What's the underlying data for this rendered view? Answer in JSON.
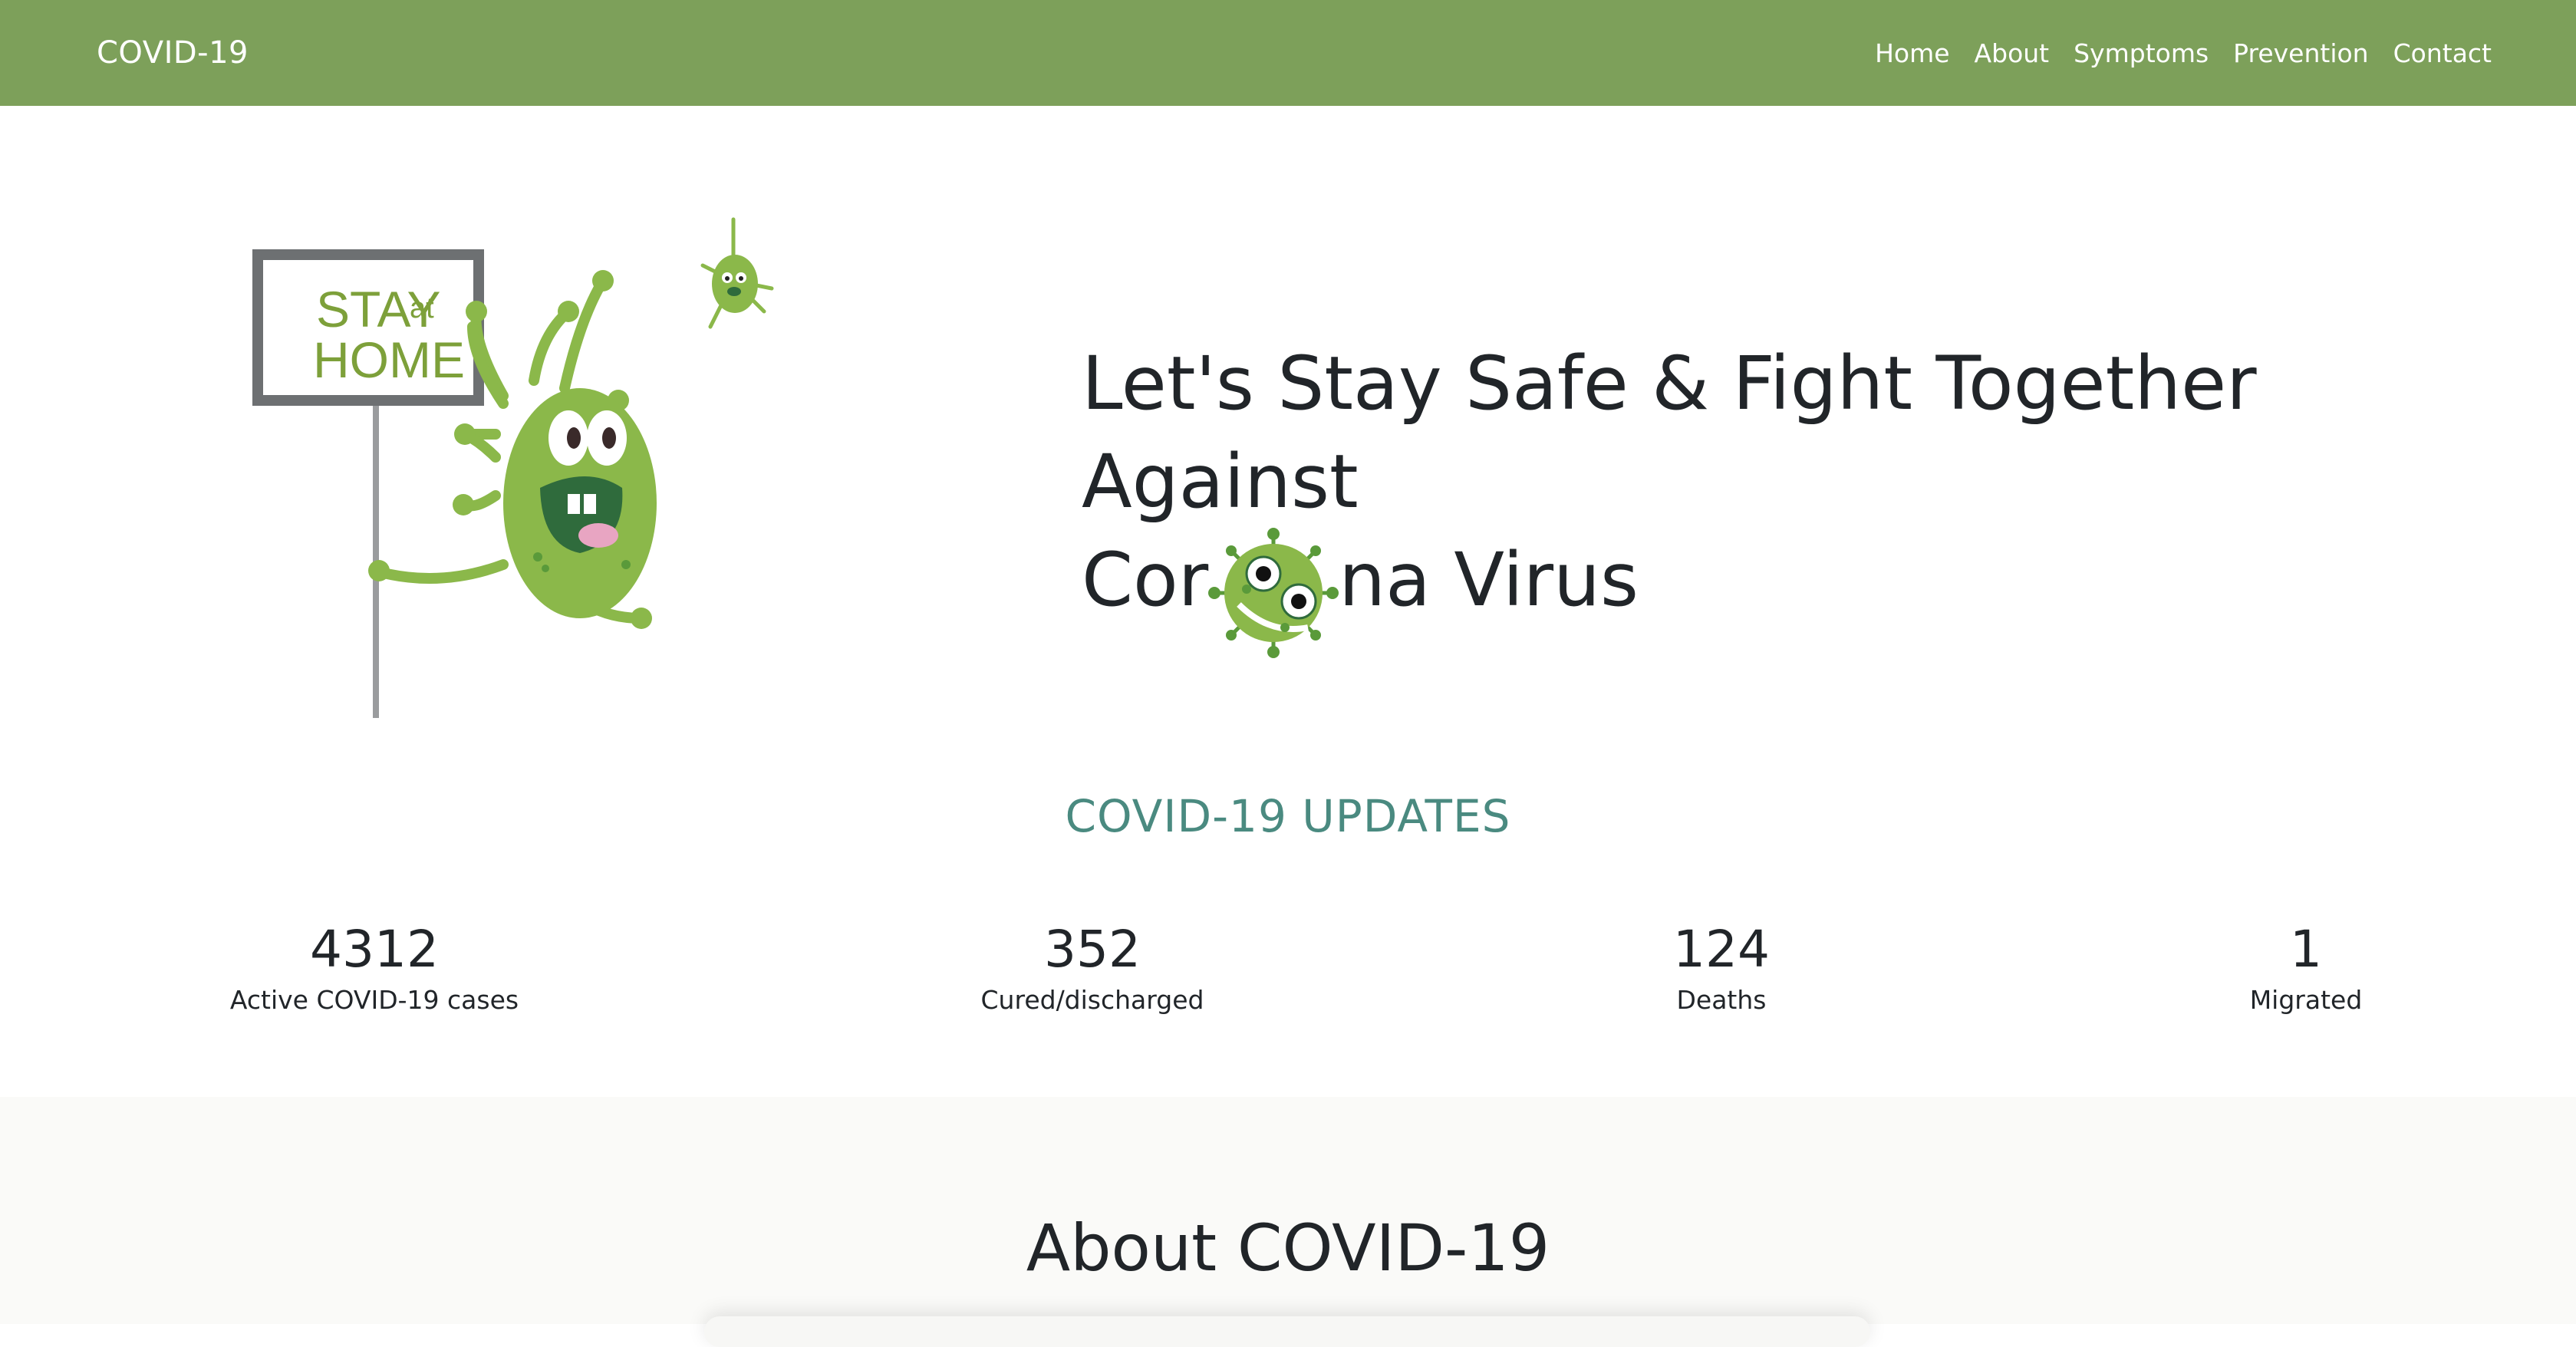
{
  "navbar": {
    "brand": "COVID-19",
    "links": [
      "Home",
      "About",
      "Symptoms",
      "Prevention",
      "Contact"
    ],
    "bg_color": "#7da05a"
  },
  "hero": {
    "sign_line1": "STAY",
    "sign_small": "at",
    "sign_line2": "HOME",
    "title_part1": "Let's Stay Safe & Fight Together Against",
    "title_part2a": "Cor",
    "title_part2b": "na Virus"
  },
  "updates": {
    "title": "COVID-19 UPDATES",
    "title_color": "#4a8a80",
    "stats": [
      {
        "value": "4312",
        "label": "Active COVID-19 cases"
      },
      {
        "value": "352",
        "label": "Cured/discharged"
      },
      {
        "value": "124",
        "label": "Deaths"
      },
      {
        "value": "1",
        "label": "Migrated"
      }
    ]
  },
  "about": {
    "title": "About COVID-19"
  },
  "colors": {
    "virus_green": "#8bb84a",
    "virus_dark": "#2f6b3c",
    "sign_frame": "#6d7072"
  }
}
